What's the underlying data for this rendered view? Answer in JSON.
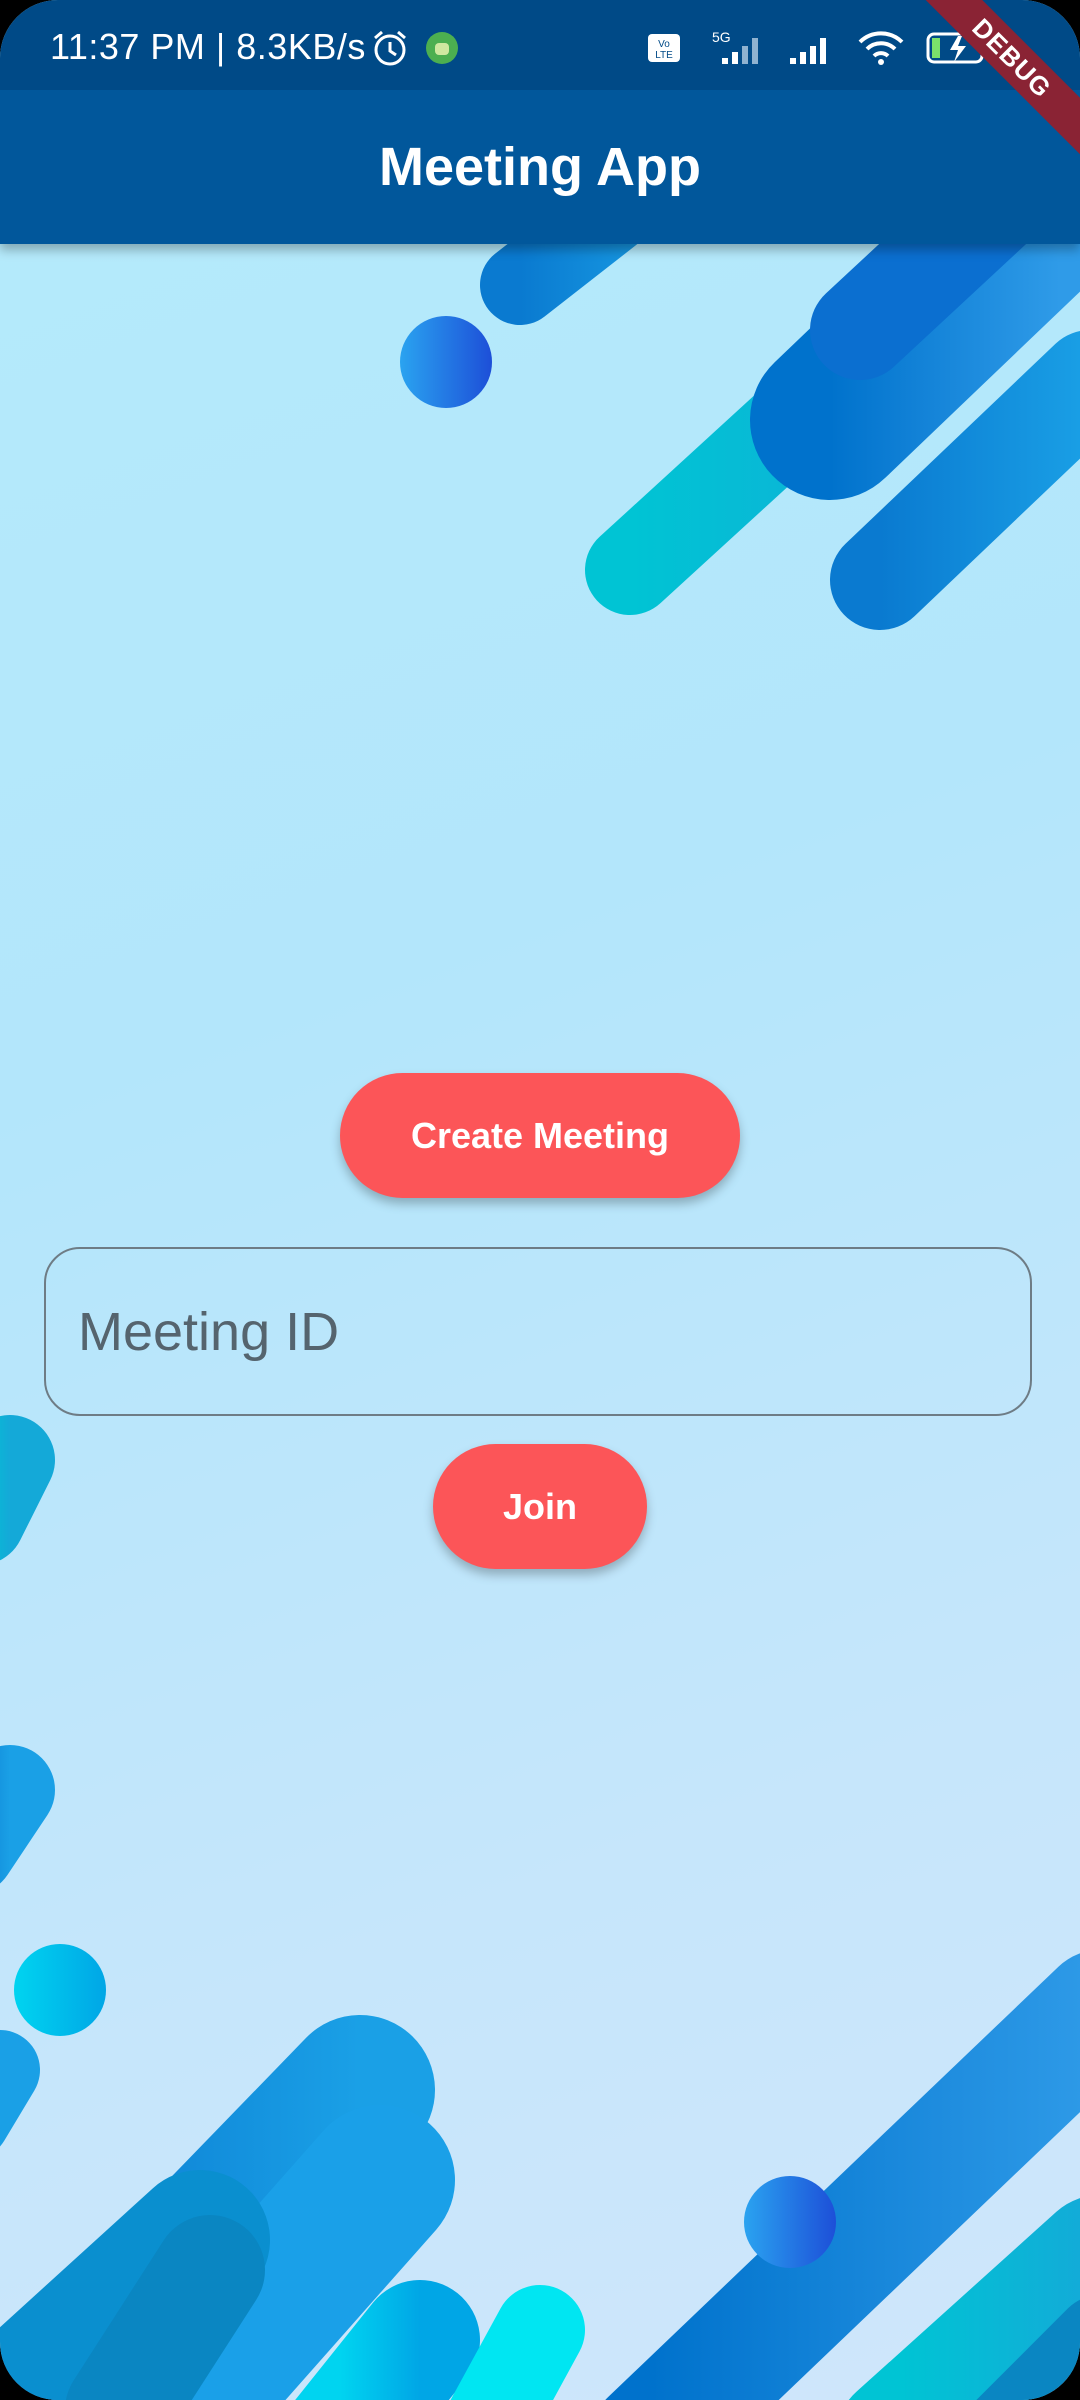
{
  "status_bar": {
    "time": "11:37 PM | 8.3KB/s",
    "icons": [
      "alarm-icon",
      "android-notification-icon",
      "volte-icon",
      "signal-5g-icon",
      "signal-icon",
      "wifi-icon",
      "battery-charging-icon"
    ]
  },
  "app_bar": {
    "title": "Meeting App",
    "debug_banner": "DEBUG"
  },
  "main": {
    "create_button_label": "Create Meeting",
    "meeting_id_placeholder": "Meeting ID",
    "meeting_id_value": "",
    "join_button_label": "Join"
  },
  "colors": {
    "status_bar": "#004a87",
    "app_bar": "#01579b",
    "button": "#fc5558",
    "background": "#b5ebfb"
  }
}
